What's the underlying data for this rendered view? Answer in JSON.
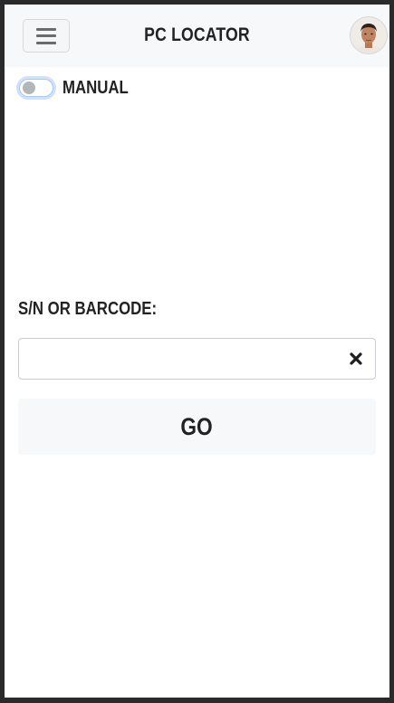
{
  "header": {
    "title": "PC LOCATOR",
    "menu_icon": "hamburger-menu-icon",
    "avatar": "user-avatar-photo"
  },
  "mode_toggle": {
    "label": "MANUAL",
    "checked": false
  },
  "lookup": {
    "label": "S/N OR BARCODE:",
    "value": "",
    "placeholder": "",
    "clear_icon": "close-icon"
  },
  "actions": {
    "go_label": "GO"
  },
  "colors": {
    "header_bg": "#f7f8fa",
    "button_bg": "#f7f8fa",
    "text": "#222222",
    "toggle_focus": "#cfe1fb",
    "frame": "#2a2a2a"
  }
}
